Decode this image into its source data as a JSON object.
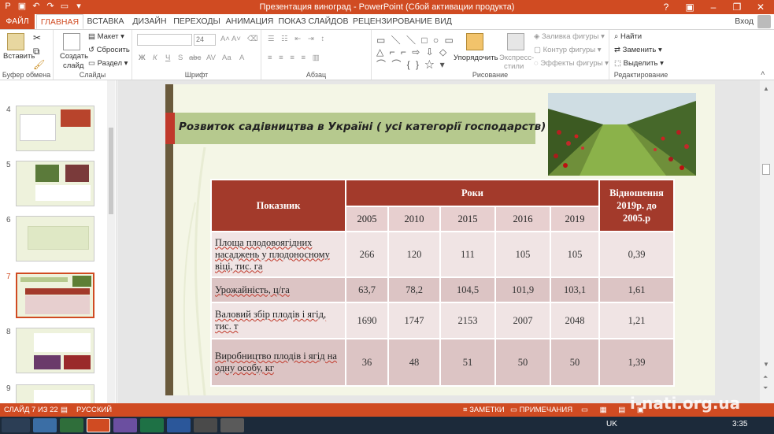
{
  "window": {
    "title": "Презентация виноград -  PowerPoint (Сбой активации продукта)",
    "controls": [
      "?",
      "▣",
      "–",
      "❐",
      "✕"
    ]
  },
  "tabs": [
    "ФАЙЛ",
    "ГЛАВНАЯ",
    "ВСТАВКА",
    "ДИЗАЙН",
    "ПЕРЕХОДЫ",
    "АНИМАЦИЯ",
    "ПОКАЗ СЛАЙДОВ",
    "РЕЦЕНЗИРОВАНИЕ",
    "ВИД"
  ],
  "signin": "Вход",
  "ribbon": {
    "clipboard": {
      "paste": "Вставить",
      "label": "Буфер обмена"
    },
    "slides": {
      "create": "Создать",
      "create2": "слайд",
      "layout": "Макет",
      "reset": "Сбросить",
      "section": "Раздел",
      "label": "Слайды"
    },
    "font": {
      "size": "24",
      "label": "Шрифт",
      "buttons": [
        "Ж",
        "К",
        "Ч",
        "S",
        "abc",
        "AV",
        "Aa",
        "A"
      ]
    },
    "paragraph": {
      "label": "Абзац"
    },
    "drawing": {
      "arrange": "Упорядочить",
      "styles": "Экспресс-",
      "styles2": "стили",
      "fill": "Заливка фигуры",
      "outline": "Контур фигуры",
      "effects": "Эффекты фигуры",
      "label": "Рисование"
    },
    "editing": {
      "find": "Найти",
      "replace": "Заменить",
      "select": "Выделить",
      "label": "Редактирование"
    }
  },
  "thumbnails": [
    "4",
    "5",
    "6",
    "7",
    "8",
    "9"
  ],
  "slide": {
    "title": "Розвиток садівництва в Україні ( усі категорії господарств)",
    "table": {
      "indicator_header": "Показник",
      "years_header": "Роки",
      "ratio_header": "Відношення 2019р. до 2005.р",
      "years": [
        "2005",
        "2010",
        "2015",
        "2016",
        "2019"
      ],
      "rows": [
        {
          "label": "Площа плодовоягідних насаджень у плодоносному віці, тис. га",
          "values": [
            "266",
            "120",
            "111",
            "105",
            "105"
          ],
          "ratio": "0,39"
        },
        {
          "label": "Урожайність, ц/га",
          "values": [
            "63,7",
            "78,2",
            "104,5",
            "101,9",
            "103,1"
          ],
          "ratio": "1,61"
        },
        {
          "label": "Валовий збір плодів і ягід, тис. т",
          "values": [
            "1690",
            "1747",
            "2153",
            "2007",
            "2048"
          ],
          "ratio": "1,21"
        },
        {
          "label": "Виробництво плодів і ягід на одну особу, кг",
          "values": [
            "36",
            "48",
            "51",
            "50",
            "50"
          ],
          "ratio": "1,39"
        }
      ]
    }
  },
  "statusbar": {
    "slide": "СЛАЙД 7 ИЗ 22",
    "lang": "РУССКИЙ",
    "notes": "ЗАМЕТКИ",
    "comments": "ПРИМЕЧАНИЯ"
  },
  "taskbar": {
    "lang": "UK",
    "time": "3:35"
  },
  "watermark": "i-nati.org.ua",
  "colors": {
    "accent": "#d04b22",
    "header": "#a33a2b",
    "title_band": "#b6c98e"
  }
}
